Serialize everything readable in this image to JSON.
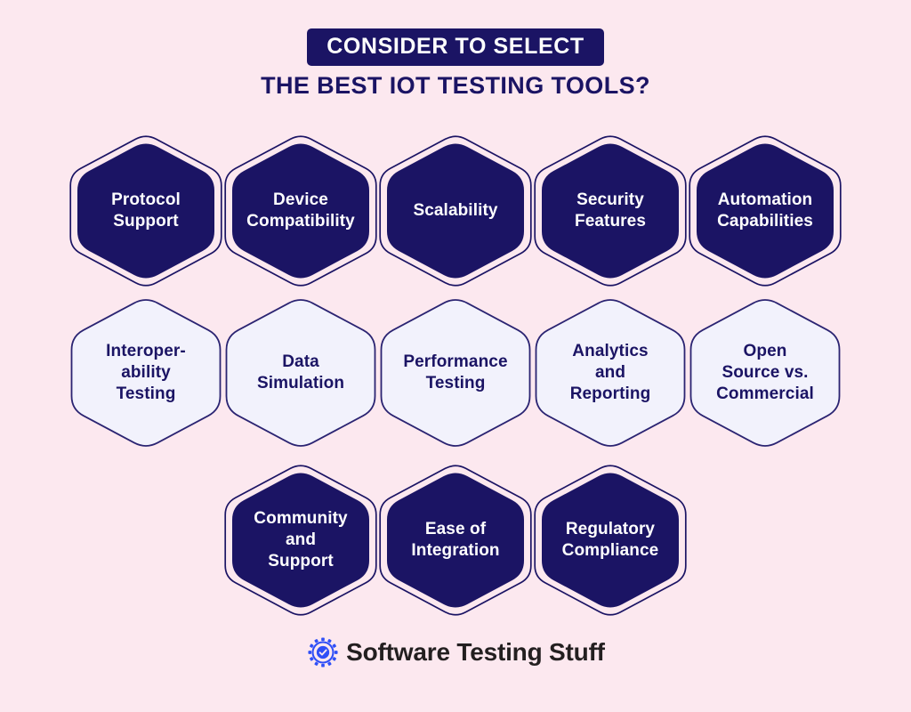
{
  "theme": {
    "background": "#FCE8EF",
    "navy": "#1B1464",
    "navy_fill": "#1B1464",
    "light_fill": "#F2F2FC",
    "light_stroke": "#2B2472",
    "white": "#FFFFFF",
    "logo_blue": "#2F4FF7",
    "logo_text": "#231F20"
  },
  "header": {
    "banner_title": "CONSIDER TO SELECT",
    "subtitle": "THE BEST IOT TESTING TOOLS?"
  },
  "rows": [
    {
      "id": "row-1",
      "style": "dark",
      "cells": [
        {
          "id": "protocol-support",
          "label": "Protocol\nSupport"
        },
        {
          "id": "device-compatibility",
          "label": "Device\nCompatibility"
        },
        {
          "id": "scalability",
          "label": "Scalability"
        },
        {
          "id": "security-features",
          "label": "Security\nFeatures"
        },
        {
          "id": "automation-capabilities",
          "label": "Automation\nCapabilities"
        }
      ]
    },
    {
      "id": "row-2",
      "style": "light",
      "cells": [
        {
          "id": "interoperability-testing",
          "label": "Interoper-\nability\nTesting"
        },
        {
          "id": "data-simulation",
          "label": "Data\nSimulation"
        },
        {
          "id": "performance-testing",
          "label": "Performance\nTesting"
        },
        {
          "id": "analytics-and-reporting",
          "label": "Analytics\nand\nReporting"
        },
        {
          "id": "open-source-vs-commercial",
          "label": "Open\nSource vs.\nCommercial"
        }
      ]
    },
    {
      "id": "row-3",
      "style": "dark",
      "cells": [
        {
          "id": "community-and-support",
          "label": "Community\nand\nSupport"
        },
        {
          "id": "ease-of-integration",
          "label": "Ease of\nIntegration"
        },
        {
          "id": "regulatory-compliance",
          "label": "Regulatory\nCompliance"
        }
      ]
    }
  ],
  "footer": {
    "brand": "Software Testing Stuff",
    "logo_icon": "gear-check-icon"
  }
}
